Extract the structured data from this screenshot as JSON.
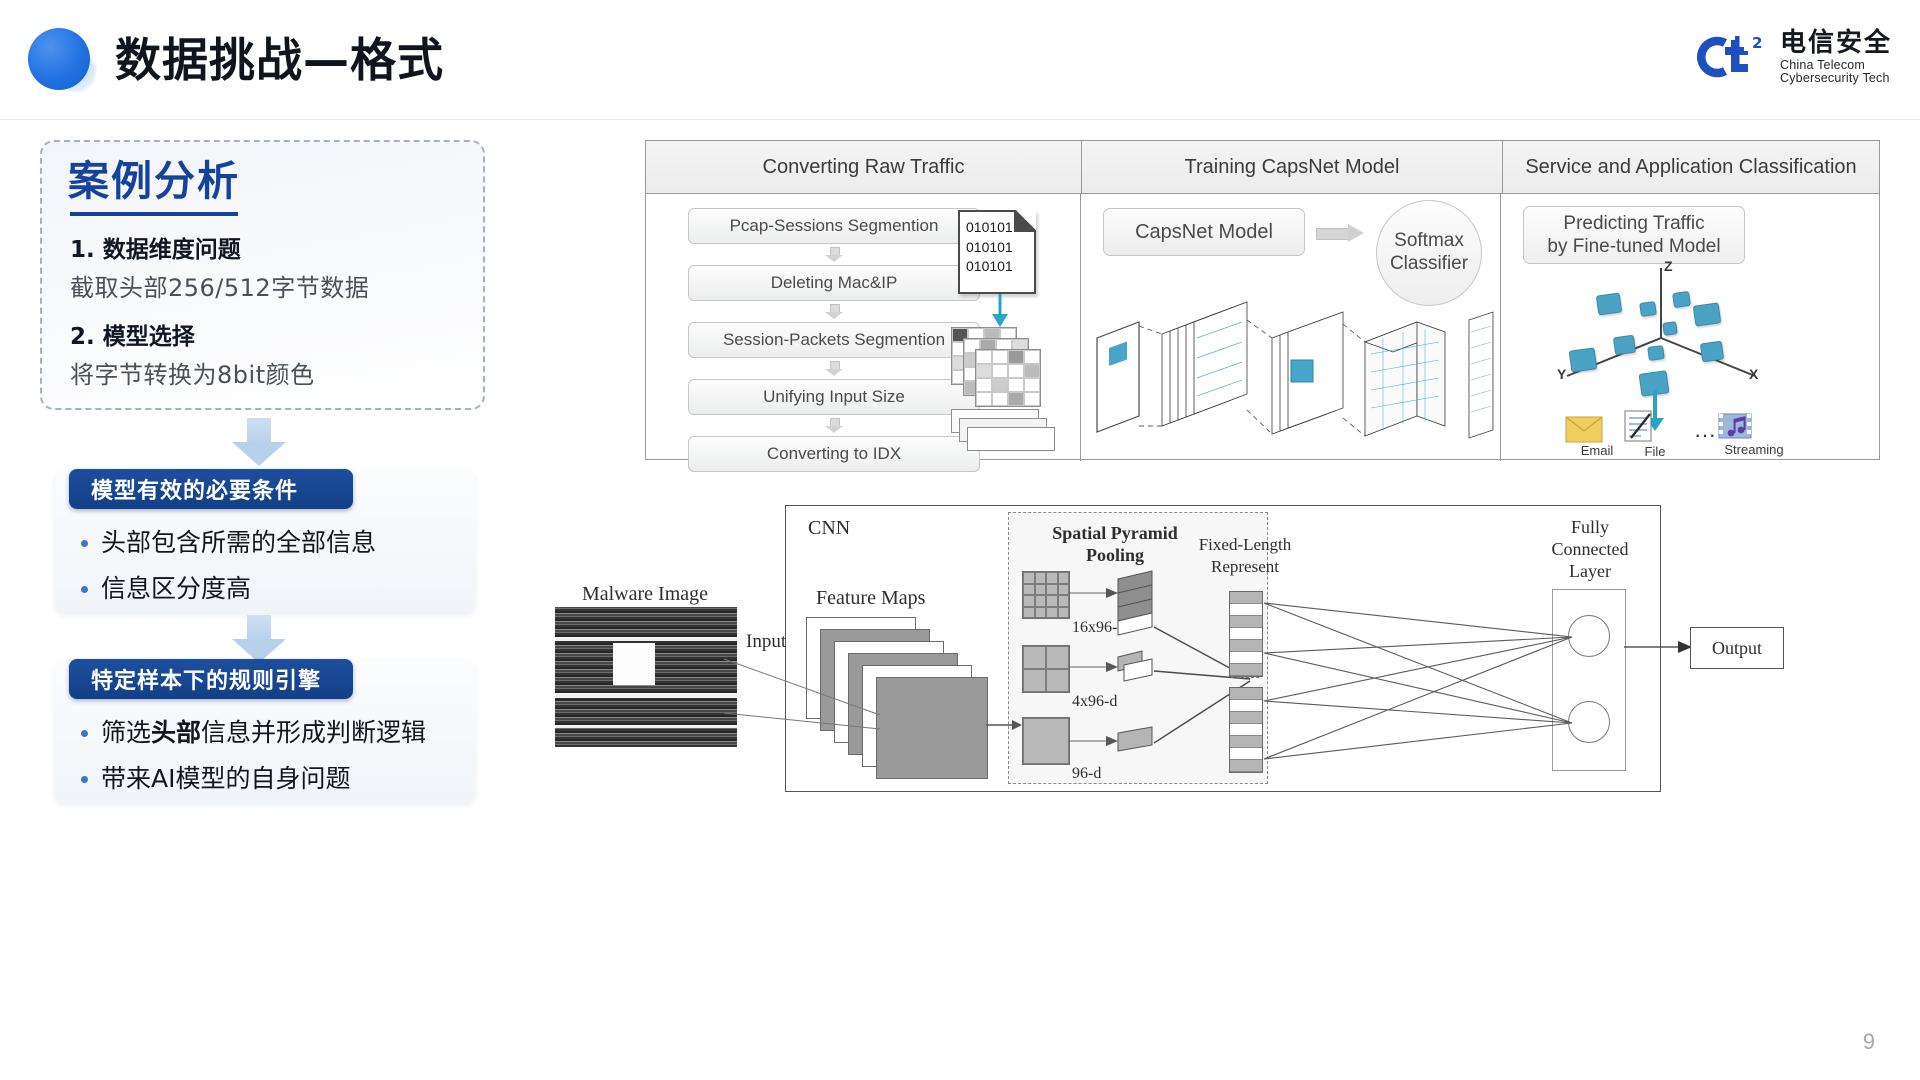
{
  "header": {
    "title": "数据挑战—格式",
    "logo": {
      "mark": "ct2",
      "cn_name": "电信安全",
      "en_line1": "China Telecom",
      "en_line2": "Cybersecurity Tech"
    }
  },
  "case_box": {
    "title": "案例分析",
    "items": [
      {
        "heading": "1. 数据维度问题",
        "detail": "截取头部256/512字节数据"
      },
      {
        "heading": "2. 模型选择",
        "detail": "将字节转换为8bit颜色"
      }
    ]
  },
  "cards": [
    {
      "tab": "模型有效的必要条件",
      "bullets": [
        {
          "pre": "头部包含所需的全部信息",
          "bold": "",
          "post": ""
        },
        {
          "pre": "信息区分度高",
          "bold": "",
          "post": ""
        }
      ]
    },
    {
      "tab": "特定样本下的规则引擎",
      "bullets": [
        {
          "pre": "筛选",
          "bold": "头部",
          "post": "信息并形成判断逻辑"
        },
        {
          "pre": "带来AI模型的自身问题",
          "bold": "",
          "post": ""
        }
      ]
    }
  ],
  "pipeline_figure": {
    "columns": [
      "Converting Raw Traffic",
      "Training CapsNet Model",
      "Service and Application Classification"
    ],
    "steps": [
      "Pcap-Sessions Segmention",
      "Deleting Mac&IP",
      "Session-Packets Segmention",
      "Unifying Input Size",
      "Converting to IDX"
    ],
    "binary_lines": [
      "010101",
      "010101",
      "010101"
    ],
    "capsnet_box": "CapsNet Model",
    "softmax": {
      "line1": "Softmax",
      "line2": "Classifier"
    },
    "predict_box": {
      "line1": "Predicting Traffic",
      "line2": "by Fine-tuned Model"
    },
    "axes": [
      "Z",
      "Y",
      "X"
    ],
    "app_icons": [
      {
        "label": "Email",
        "icon": "envelope-icon"
      },
      {
        "label": "File",
        "icon": "document-pen-icon"
      },
      {
        "label": "",
        "icon": "ellipsis-icon"
      },
      {
        "label": "Streaming",
        "icon": "media-icon"
      }
    ]
  },
  "cnn_figure": {
    "cnn_label": "CNN",
    "malware_label": "Malware Image",
    "input_label": "Input",
    "feature_maps_label": "Feature Maps",
    "spp_title_line1": "Spatial Pyramid",
    "spp_title_line2": "Pooling",
    "spp_dims": [
      "16x96-d",
      "4x96-d",
      "96-d"
    ],
    "fixed_len_line1": "Fixed-Length",
    "fixed_len_line2": "Represent",
    "fc_line1": "Fully",
    "fc_line2": "Connected",
    "fc_line3": "Layer",
    "output_label": "Output"
  },
  "page_number": "9",
  "colors": {
    "brand_blue": "#16429c",
    "tab_blue": "#1d4e9e",
    "accent_cyan": "#2aa3c8",
    "cube_teal": "#4aa3c4"
  }
}
